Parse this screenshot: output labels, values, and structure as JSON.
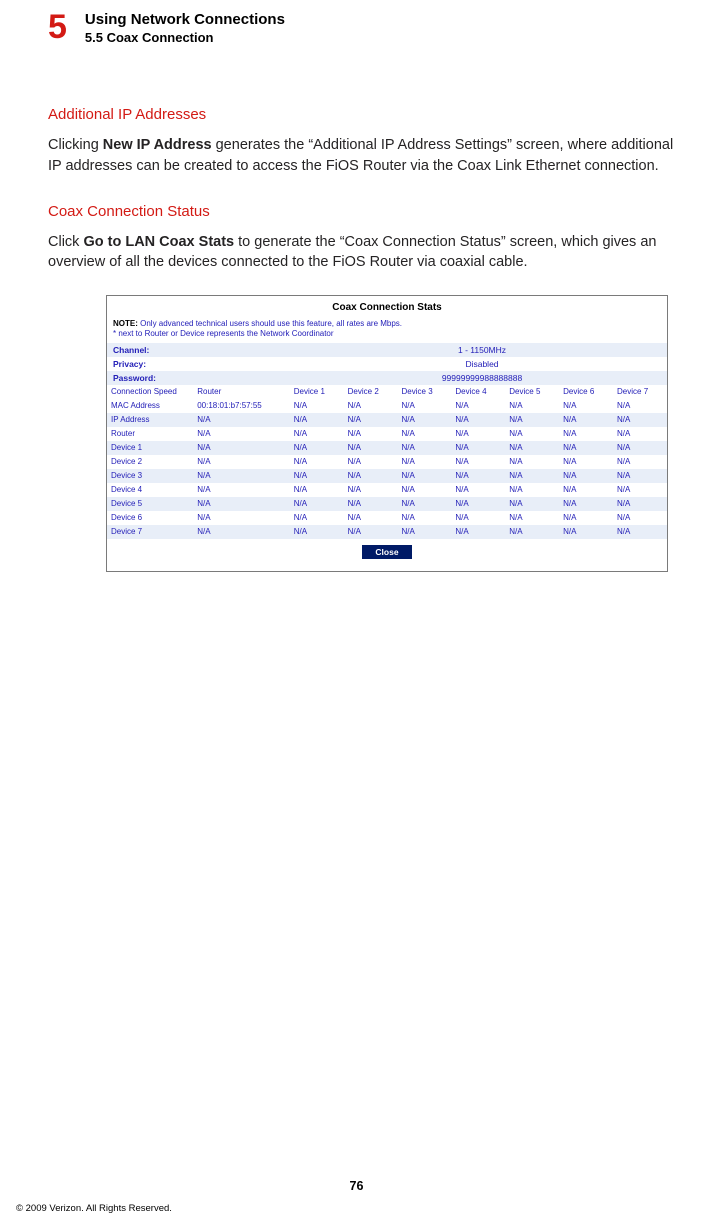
{
  "chapter": {
    "number": "5",
    "title": "Using Network Connections",
    "sub": "5.5  Coax Connection"
  },
  "section1": {
    "heading": "Additional IP Addresses",
    "p_pre": "Clicking ",
    "p_bold": "New IP Address",
    "p_post": " generates the “Additional IP Address Settings” screen, where additional IP addresses can be created to access the FiOS Router via the Coax Link Ethernet connection."
  },
  "section2": {
    "heading": "Coax Connection Status",
    "p_pre": "Click ",
    "p_bold": "Go to LAN Coax Stats",
    "p_post": " to generate the “Coax Connection Status” screen, which gives an overview of all the devices connected to the FiOS Router via coaxial cable."
  },
  "screenshot": {
    "title": "Coax Connection Stats",
    "note_label": "NOTE:",
    "note_line1": " Only advanced technical users should use this feature, all rates are Mbps.",
    "note_line2": "* next to Router or Device represents the Network Coordinator",
    "kv": {
      "channel_k": "Channel:",
      "channel_v": "1 - 1150MHz",
      "privacy_k": "Privacy:",
      "privacy_v": "Disabled",
      "password_k": "Password:",
      "password_v": "99999999988888888"
    },
    "headers": [
      "Connection Speed",
      "Router",
      "Device 1",
      "Device 2",
      "Device 3",
      "Device 4",
      "Device 5",
      "Device 6",
      "Device 7"
    ],
    "rows": [
      {
        "label": "MAC Address",
        "router": "00:18:01:b7:57:55",
        "d": [
          "N/A",
          "N/A",
          "N/A",
          "N/A",
          "N/A",
          "N/A",
          "N/A"
        ]
      },
      {
        "label": "IP Address",
        "router": "N/A",
        "d": [
          "N/A",
          "N/A",
          "N/A",
          "N/A",
          "N/A",
          "N/A",
          "N/A"
        ]
      },
      {
        "label": "Router",
        "router": "N/A",
        "d": [
          "N/A",
          "N/A",
          "N/A",
          "N/A",
          "N/A",
          "N/A",
          "N/A"
        ]
      },
      {
        "label": "Device 1",
        "router": "N/A",
        "d": [
          "N/A",
          "N/A",
          "N/A",
          "N/A",
          "N/A",
          "N/A",
          "N/A"
        ]
      },
      {
        "label": "Device 2",
        "router": "N/A",
        "d": [
          "N/A",
          "N/A",
          "N/A",
          "N/A",
          "N/A",
          "N/A",
          "N/A"
        ]
      },
      {
        "label": "Device 3",
        "router": "N/A",
        "d": [
          "N/A",
          "N/A",
          "N/A",
          "N/A",
          "N/A",
          "N/A",
          "N/A"
        ]
      },
      {
        "label": "Device 4",
        "router": "N/A",
        "d": [
          "N/A",
          "N/A",
          "N/A",
          "N/A",
          "N/A",
          "N/A",
          "N/A"
        ]
      },
      {
        "label": "Device 5",
        "router": "N/A",
        "d": [
          "N/A",
          "N/A",
          "N/A",
          "N/A",
          "N/A",
          "N/A",
          "N/A"
        ]
      },
      {
        "label": "Device 6",
        "router": "N/A",
        "d": [
          "N/A",
          "N/A",
          "N/A",
          "N/A",
          "N/A",
          "N/A",
          "N/A"
        ]
      },
      {
        "label": "Device 7",
        "router": "N/A",
        "d": [
          "N/A",
          "N/A",
          "N/A",
          "N/A",
          "N/A",
          "N/A",
          "N/A"
        ]
      }
    ],
    "close": "Close"
  },
  "page_number": "76",
  "copyright": "© 2009 Verizon. All Rights Reserved."
}
